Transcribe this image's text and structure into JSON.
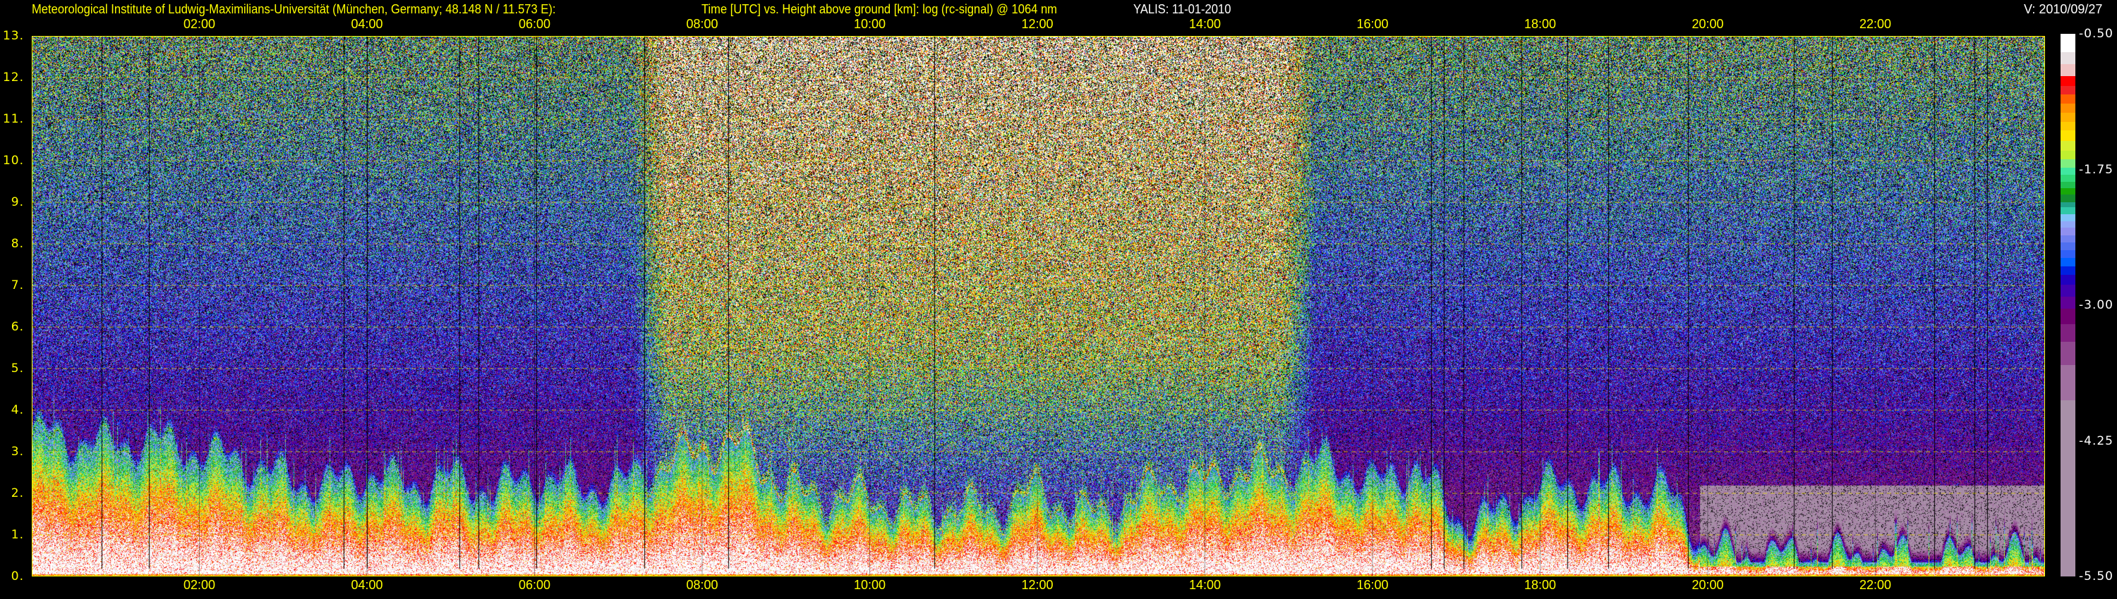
{
  "header": {
    "institute": "Meteorological Institute of Ludwig-Maximilians-Universität (München, Germany; 48.148 N / 11.573 E):",
    "title": "Time [UTC] vs. Height above ground [km]: log (rc-signal) @ 1064 nm",
    "instrument_date": "YALIS: 11-01-2010",
    "version": "V: 2010/09/27"
  },
  "chart_data": {
    "type": "heatmap",
    "title": "Time [UTC] vs. Height above ground [km]: log (rc-signal) @ 1064 nm",
    "xlabel": "Time [UTC]",
    "ylabel": "Height above ground [km]",
    "xlim": [
      0,
      24
    ],
    "ylim": [
      0,
      13
    ],
    "x_ticks": [
      "02:00",
      "04:00",
      "06:00",
      "08:00",
      "10:00",
      "12:00",
      "14:00",
      "16:00",
      "18:00",
      "20:00",
      "22:00"
    ],
    "x_tick_hours": [
      2,
      4,
      6,
      8,
      10,
      12,
      14,
      16,
      18,
      20,
      22
    ],
    "y_ticks": [
      "0.",
      "1.",
      "2.",
      "3.",
      "4.",
      "5.",
      "6.",
      "7.",
      "8.",
      "9.",
      "10.",
      "11.",
      "12.",
      "13."
    ],
    "y_tick_values": [
      0,
      1,
      2,
      3,
      4,
      5,
      6,
      7,
      8,
      9,
      10,
      11,
      12,
      13
    ],
    "grid": true,
    "colorbar": {
      "range": [
        -5.5,
        -0.5
      ],
      "ticks": [
        "-0.50",
        "-1.75",
        "-3.00",
        "-4.25",
        "-5.50"
      ],
      "tick_values": [
        -0.5,
        -1.75,
        -3.0,
        -4.25,
        -5.5
      ],
      "stops": [
        [
          -0.5,
          "#ffffff"
        ],
        [
          -0.669,
          "#e8e0e2"
        ],
        [
          -0.782,
          "#f0c4c4"
        ],
        [
          -0.891,
          "#ff0000"
        ],
        [
          -0.98,
          "#f02424"
        ],
        [
          -1.057,
          "#ff6000"
        ],
        [
          -1.145,
          "#ff9000"
        ],
        [
          -1.226,
          "#ffb000"
        ],
        [
          -1.311,
          "#ffcc00"
        ],
        [
          -1.392,
          "#ffe400"
        ],
        [
          -1.487,
          "#d8f030"
        ],
        [
          -1.579,
          "#c0f030"
        ],
        [
          -1.657,
          "#80f080"
        ],
        [
          -1.734,
          "#40e8a0"
        ],
        [
          -1.798,
          "#30d878"
        ],
        [
          -1.861,
          "#20c050"
        ],
        [
          -1.921,
          "#18a808"
        ],
        [
          -1.981,
          "#148c30"
        ],
        [
          -2.051,
          "#20a088"
        ],
        [
          -2.097,
          "#30c8a8"
        ],
        [
          -2.161,
          "#80c4f8"
        ],
        [
          -2.228,
          "#90a8f8"
        ],
        [
          -2.284,
          "#9090f0"
        ],
        [
          -2.355,
          "#7080f0"
        ],
        [
          -2.425,
          "#5070f0"
        ],
        [
          -2.496,
          "#3060f8"
        ],
        [
          -2.566,
          "#0060ff"
        ],
        [
          -2.644,
          "#0020e0"
        ],
        [
          -2.721,
          "#2000c0"
        ],
        [
          -2.813,
          "#4000b0"
        ],
        [
          -2.919,
          "#600098"
        ],
        [
          -3.032,
          "#700070"
        ],
        [
          -3.173,
          "#802080"
        ],
        [
          -3.338,
          "#904890"
        ],
        [
          -3.554,
          "#a070a0"
        ],
        [
          -3.878,
          "#a890a8"
        ]
      ]
    },
    "aerosol_layer_top_km": {
      "hours": [
        0,
        0.5,
        1,
        1.5,
        2,
        2.5,
        3,
        3.5,
        4,
        4.5,
        5,
        5.5,
        6,
        6.5,
        7,
        7.5,
        8,
        8.5,
        9,
        9.5,
        10,
        10.5,
        11,
        11.5,
        12,
        12.5,
        13,
        13.5,
        14,
        14.5,
        15,
        15.5,
        16,
        16.5,
        17,
        17.5,
        18,
        18.5,
        19,
        19.5,
        20,
        20.5,
        21,
        22,
        23,
        24
      ],
      "values": [
        3.3,
        3.1,
        3.0,
        3.1,
        2.8,
        2.6,
        2.2,
        2.0,
        2.3,
        2.0,
        2.2,
        1.9,
        2.2,
        2.0,
        2.0,
        2.6,
        3.0,
        3.1,
        2.0,
        1.8,
        1.8,
        1.5,
        1.6,
        1.5,
        2.0,
        1.4,
        1.6,
        2.2,
        2.2,
        2.5,
        2.4,
        2.6,
        2.0,
        2.5,
        1.2,
        1.3,
        2.0,
        2.0,
        1.9,
        1.9,
        0.6,
        0.5,
        0.5,
        0.45,
        0.45,
        0.5
      ]
    },
    "daytime_enhanced_hours": [
      7.3,
      15.2
    ]
  }
}
